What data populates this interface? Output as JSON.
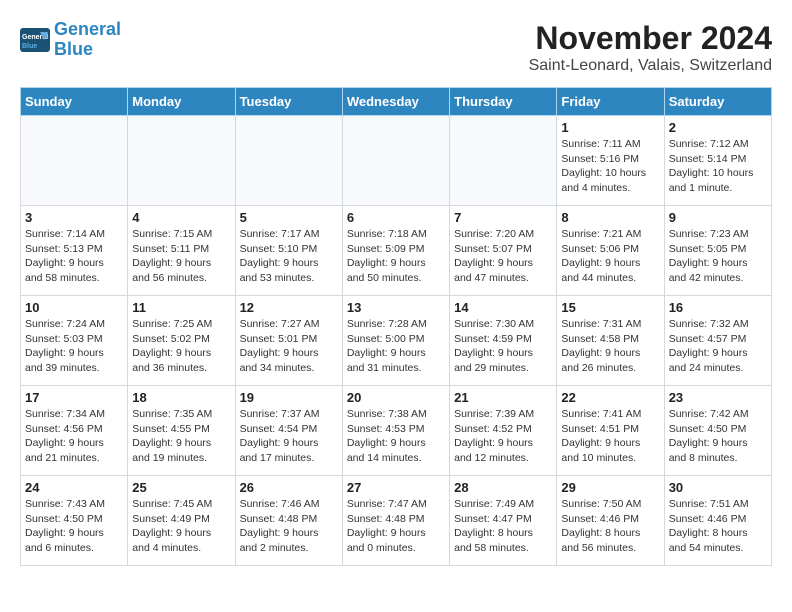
{
  "header": {
    "logo_line1": "General",
    "logo_line2": "Blue",
    "month_title": "November 2024",
    "location": "Saint-Leonard, Valais, Switzerland"
  },
  "weekdays": [
    "Sunday",
    "Monday",
    "Tuesday",
    "Wednesday",
    "Thursday",
    "Friday",
    "Saturday"
  ],
  "weeks": [
    [
      {
        "day": "",
        "info": ""
      },
      {
        "day": "",
        "info": ""
      },
      {
        "day": "",
        "info": ""
      },
      {
        "day": "",
        "info": ""
      },
      {
        "day": "",
        "info": ""
      },
      {
        "day": "1",
        "info": "Sunrise: 7:11 AM\nSunset: 5:16 PM\nDaylight: 10 hours\nand 4 minutes."
      },
      {
        "day": "2",
        "info": "Sunrise: 7:12 AM\nSunset: 5:14 PM\nDaylight: 10 hours\nand 1 minute."
      }
    ],
    [
      {
        "day": "3",
        "info": "Sunrise: 7:14 AM\nSunset: 5:13 PM\nDaylight: 9 hours\nand 58 minutes."
      },
      {
        "day": "4",
        "info": "Sunrise: 7:15 AM\nSunset: 5:11 PM\nDaylight: 9 hours\nand 56 minutes."
      },
      {
        "day": "5",
        "info": "Sunrise: 7:17 AM\nSunset: 5:10 PM\nDaylight: 9 hours\nand 53 minutes."
      },
      {
        "day": "6",
        "info": "Sunrise: 7:18 AM\nSunset: 5:09 PM\nDaylight: 9 hours\nand 50 minutes."
      },
      {
        "day": "7",
        "info": "Sunrise: 7:20 AM\nSunset: 5:07 PM\nDaylight: 9 hours\nand 47 minutes."
      },
      {
        "day": "8",
        "info": "Sunrise: 7:21 AM\nSunset: 5:06 PM\nDaylight: 9 hours\nand 44 minutes."
      },
      {
        "day": "9",
        "info": "Sunrise: 7:23 AM\nSunset: 5:05 PM\nDaylight: 9 hours\nand 42 minutes."
      }
    ],
    [
      {
        "day": "10",
        "info": "Sunrise: 7:24 AM\nSunset: 5:03 PM\nDaylight: 9 hours\nand 39 minutes."
      },
      {
        "day": "11",
        "info": "Sunrise: 7:25 AM\nSunset: 5:02 PM\nDaylight: 9 hours\nand 36 minutes."
      },
      {
        "day": "12",
        "info": "Sunrise: 7:27 AM\nSunset: 5:01 PM\nDaylight: 9 hours\nand 34 minutes."
      },
      {
        "day": "13",
        "info": "Sunrise: 7:28 AM\nSunset: 5:00 PM\nDaylight: 9 hours\nand 31 minutes."
      },
      {
        "day": "14",
        "info": "Sunrise: 7:30 AM\nSunset: 4:59 PM\nDaylight: 9 hours\nand 29 minutes."
      },
      {
        "day": "15",
        "info": "Sunrise: 7:31 AM\nSunset: 4:58 PM\nDaylight: 9 hours\nand 26 minutes."
      },
      {
        "day": "16",
        "info": "Sunrise: 7:32 AM\nSunset: 4:57 PM\nDaylight: 9 hours\nand 24 minutes."
      }
    ],
    [
      {
        "day": "17",
        "info": "Sunrise: 7:34 AM\nSunset: 4:56 PM\nDaylight: 9 hours\nand 21 minutes."
      },
      {
        "day": "18",
        "info": "Sunrise: 7:35 AM\nSunset: 4:55 PM\nDaylight: 9 hours\nand 19 minutes."
      },
      {
        "day": "19",
        "info": "Sunrise: 7:37 AM\nSunset: 4:54 PM\nDaylight: 9 hours\nand 17 minutes."
      },
      {
        "day": "20",
        "info": "Sunrise: 7:38 AM\nSunset: 4:53 PM\nDaylight: 9 hours\nand 14 minutes."
      },
      {
        "day": "21",
        "info": "Sunrise: 7:39 AM\nSunset: 4:52 PM\nDaylight: 9 hours\nand 12 minutes."
      },
      {
        "day": "22",
        "info": "Sunrise: 7:41 AM\nSunset: 4:51 PM\nDaylight: 9 hours\nand 10 minutes."
      },
      {
        "day": "23",
        "info": "Sunrise: 7:42 AM\nSunset: 4:50 PM\nDaylight: 9 hours\nand 8 minutes."
      }
    ],
    [
      {
        "day": "24",
        "info": "Sunrise: 7:43 AM\nSunset: 4:50 PM\nDaylight: 9 hours\nand 6 minutes."
      },
      {
        "day": "25",
        "info": "Sunrise: 7:45 AM\nSunset: 4:49 PM\nDaylight: 9 hours\nand 4 minutes."
      },
      {
        "day": "26",
        "info": "Sunrise: 7:46 AM\nSunset: 4:48 PM\nDaylight: 9 hours\nand 2 minutes."
      },
      {
        "day": "27",
        "info": "Sunrise: 7:47 AM\nSunset: 4:48 PM\nDaylight: 9 hours\nand 0 minutes."
      },
      {
        "day": "28",
        "info": "Sunrise: 7:49 AM\nSunset: 4:47 PM\nDaylight: 8 hours\nand 58 minutes."
      },
      {
        "day": "29",
        "info": "Sunrise: 7:50 AM\nSunset: 4:46 PM\nDaylight: 8 hours\nand 56 minutes."
      },
      {
        "day": "30",
        "info": "Sunrise: 7:51 AM\nSunset: 4:46 PM\nDaylight: 8 hours\nand 54 minutes."
      }
    ]
  ]
}
